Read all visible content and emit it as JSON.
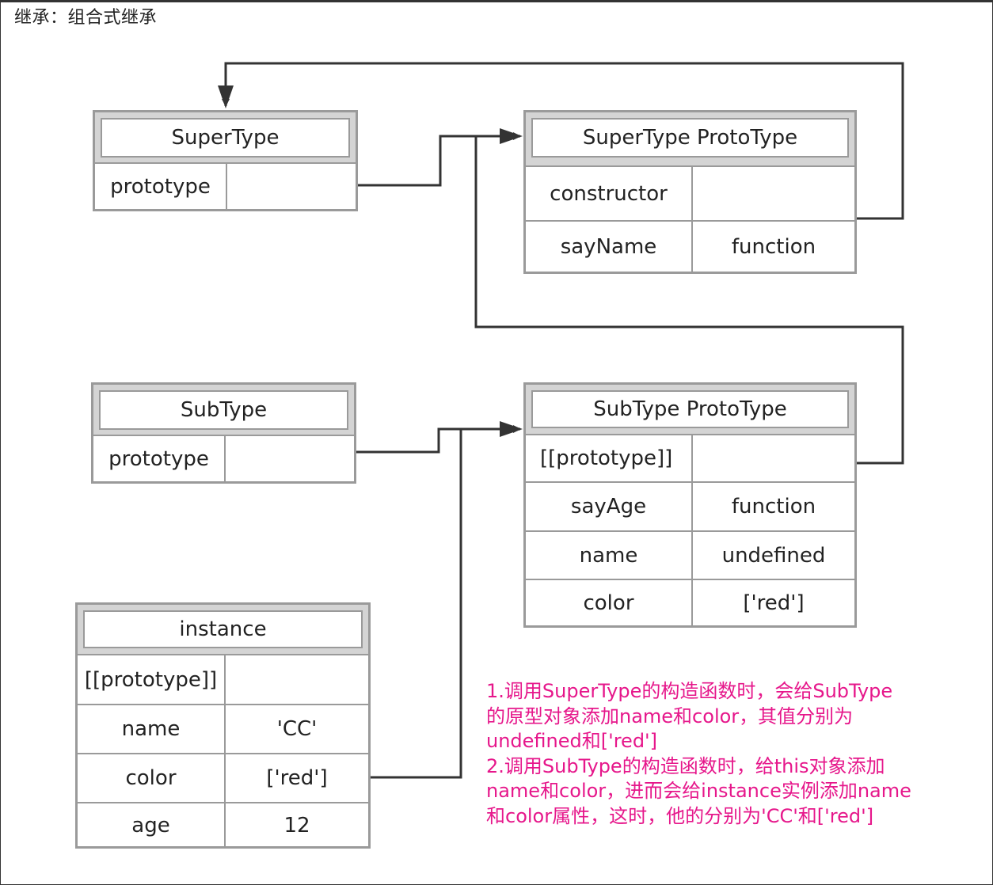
{
  "title": "继承：组合式继承",
  "supertype": {
    "title": "SuperType",
    "rows": [
      {
        "key": "prototype",
        "value": ""
      }
    ]
  },
  "supertype_proto": {
    "title": "SuperType ProtoType",
    "rows": [
      {
        "key": "constructor",
        "value": ""
      },
      {
        "key": "sayName",
        "value": "function"
      }
    ]
  },
  "subtype": {
    "title": "SubType",
    "rows": [
      {
        "key": "prototype",
        "value": ""
      }
    ]
  },
  "subtype_proto": {
    "title": "SubType ProtoType",
    "rows": [
      {
        "key": "[[prototype]]",
        "value": ""
      },
      {
        "key": "sayAge",
        "value": "function"
      },
      {
        "key": "name",
        "value": "undefined"
      },
      {
        "key": "color",
        "value": "['red']"
      }
    ]
  },
  "instance": {
    "title": "instance",
    "rows": [
      {
        "key": "[[prototype]]",
        "value": ""
      },
      {
        "key": "name",
        "value": "'CC'"
      },
      {
        "key": "color",
        "value": "['red']"
      },
      {
        "key": "age",
        "value": "12"
      }
    ]
  },
  "note": {
    "lines": [
      "1.调用SuperType的构造函数时，会给SubType",
      "的原型对象添加name和color，其值分别为",
      "undefined和['red']",
      "2.调用SubType的构造函数时，给this对象添加",
      "name和color，进而会给instance实例添加name",
      "和color属性，这时，他的分别为'CC'和['red']"
    ],
    "color": "#e6178b"
  },
  "colors": {
    "box_border": "#9a9a9a",
    "box_header": "#d4d4d4",
    "connector": "#333333"
  }
}
